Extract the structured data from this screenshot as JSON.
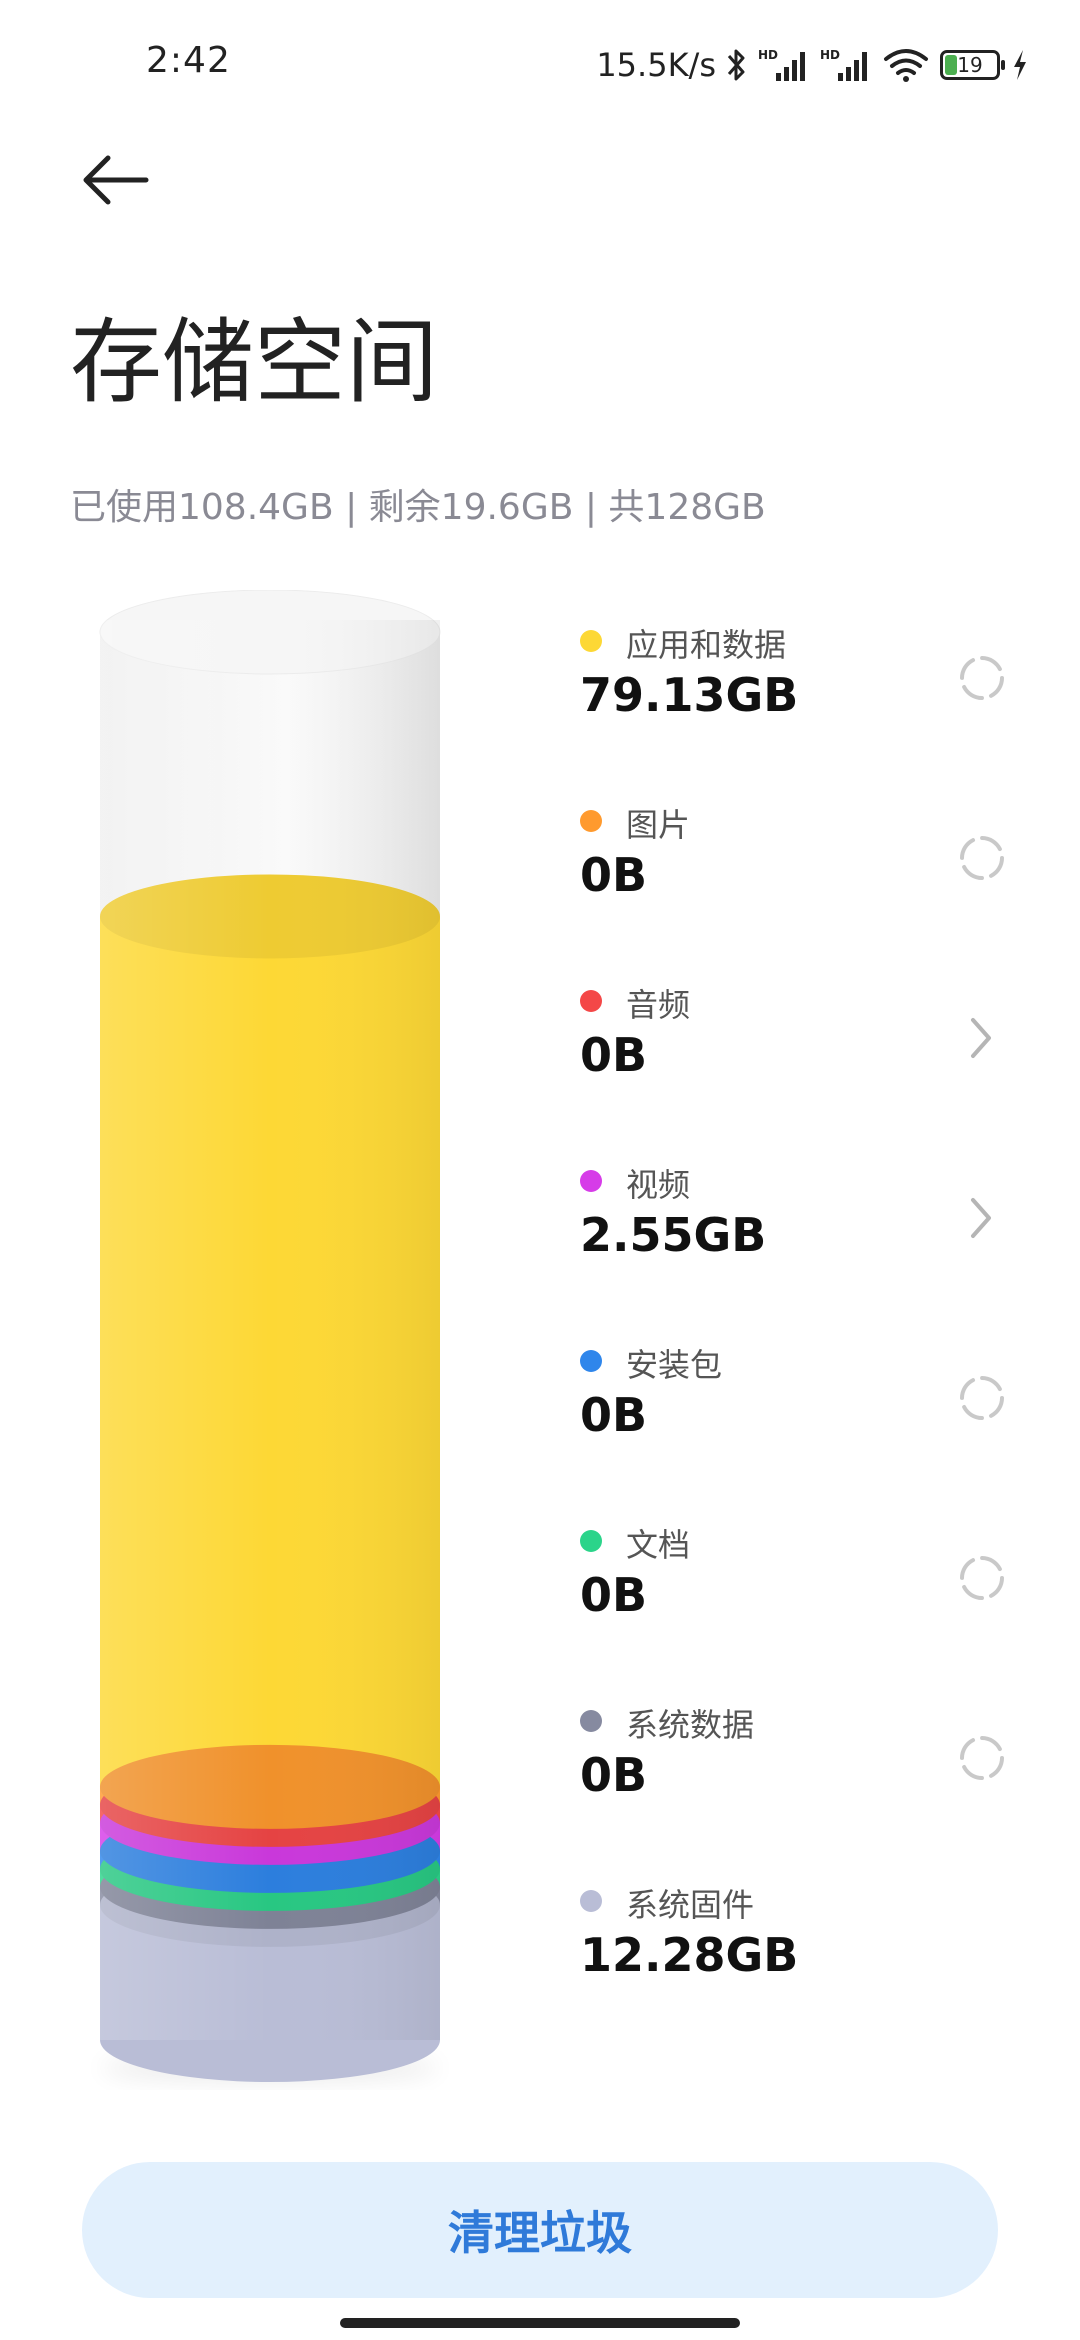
{
  "status_bar": {
    "time": "2:42",
    "net_speed": "15.5K/s",
    "battery_level": "19",
    "icons": [
      "bluetooth-icon",
      "hd-signal-icon",
      "hd-signal-icon",
      "wifi-icon",
      "battery-icon",
      "charging-icon"
    ]
  },
  "header": {
    "back_icon": "arrow-left-icon",
    "title": "存储空间"
  },
  "summary": {
    "text": "已使用108.4GB | 剩余19.6GB | 共128GB"
  },
  "storage": {
    "total_gb": 128,
    "free_gb": 19.6,
    "categories": [
      {
        "name": "应用和数据",
        "size": "79.13GB",
        "value_gb": 79.13,
        "color": "#fdd835",
        "action": "loading-spinner-icon"
      },
      {
        "name": "图片",
        "size": "0B",
        "value_gb": 0,
        "color": "#ff9a2e",
        "action": "loading-spinner-icon"
      },
      {
        "name": "音频",
        "size": "0B",
        "value_gb": 0,
        "color": "#f44747",
        "action": "chevron-right-icon"
      },
      {
        "name": "视频",
        "size": "2.55GB",
        "value_gb": 2.55,
        "color": "#d63ce8",
        "action": "chevron-right-icon"
      },
      {
        "name": "安装包",
        "size": "0B",
        "value_gb": 0,
        "color": "#2f86eb",
        "action": "loading-spinner-icon"
      },
      {
        "name": "文档",
        "size": "0B",
        "value_gb": 0,
        "color": "#2bd48a",
        "action": "loading-spinner-icon"
      },
      {
        "name": "系统数据",
        "size": "0B",
        "value_gb": 0,
        "color": "#868aa0",
        "action": "loading-spinner-icon"
      },
      {
        "name": "系统固件",
        "size": "12.28GB",
        "value_gb": 12.28,
        "color": "#b9bdd6",
        "action": ""
      }
    ],
    "free_color": "#f3f3f3"
  },
  "footer": {
    "clean_button_label": "清理垃圾"
  }
}
